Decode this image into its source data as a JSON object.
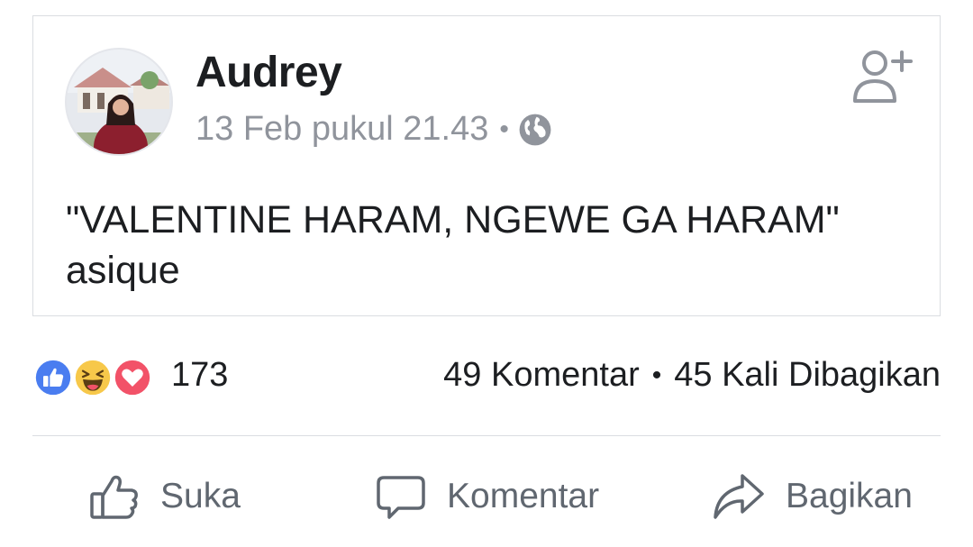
{
  "post": {
    "author": "Audrey",
    "timestamp": "13 Feb pukul 21.43",
    "meta_separator": "•",
    "privacy_icon": "globe-icon",
    "text_line_1": "\"VALENTINE HARAM, NGEWE GA HARAM\"",
    "text_line_2": "asique"
  },
  "reactions": {
    "icons": [
      "like-icon",
      "haha-icon",
      "love-icon"
    ],
    "count": "173",
    "comments": "49 Komentar",
    "separator": "•",
    "shares": "45 Kali Dibagikan"
  },
  "actions": {
    "like_label": "Suka",
    "comment_label": "Komentar",
    "share_label": "Bagikan"
  },
  "colors": {
    "like_blue": "#4a7df0",
    "haha_yellow": "#f7c84a",
    "love_red": "#f25268",
    "secondary_text": "#90949c",
    "action_text": "#606770"
  }
}
